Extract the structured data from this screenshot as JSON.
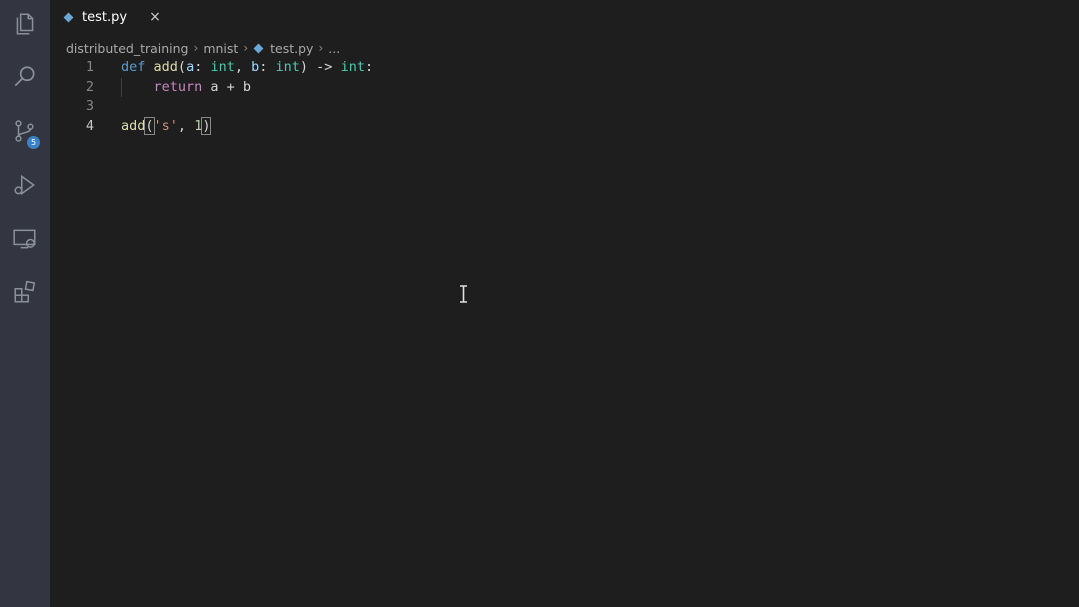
{
  "activity_bar": {
    "icons": [
      "files-icon",
      "search-icon",
      "source-control-icon",
      "run-debug-icon",
      "remote-explorer-icon",
      "extensions-icon"
    ],
    "source_control_badge": "5"
  },
  "tab": {
    "label": "test.py",
    "close_icon": "×"
  },
  "breadcrumb": {
    "items": [
      "distributed_training",
      "mnist",
      "test.py",
      "..."
    ]
  },
  "editor": {
    "lines": [
      {
        "number": "1",
        "tokens": [
          [
            "kw",
            "def"
          ],
          [
            "plain",
            " "
          ],
          [
            "fn",
            "add"
          ],
          [
            "plain",
            "("
          ],
          [
            "param",
            "a"
          ],
          [
            "plain",
            ": "
          ],
          [
            "type",
            "int"
          ],
          [
            "plain",
            ", "
          ],
          [
            "param",
            "b"
          ],
          [
            "plain",
            ": "
          ],
          [
            "type",
            "int"
          ],
          [
            "plain",
            ") -> "
          ],
          [
            "type",
            "int"
          ],
          [
            "plain",
            ":"
          ]
        ]
      },
      {
        "number": "2",
        "tokens": [
          [
            "plain",
            "    "
          ],
          [
            "kw2",
            "return"
          ],
          [
            "plain",
            " a + b"
          ]
        ]
      },
      {
        "number": "3",
        "tokens": []
      },
      {
        "number": "4",
        "tokens": [
          [
            "fn",
            "add"
          ],
          [
            "brk",
            "("
          ],
          [
            "str",
            "'s'"
          ],
          [
            "plain",
            ", "
          ],
          [
            "num",
            "1"
          ],
          [
            "brk",
            ")"
          ]
        ]
      }
    ]
  },
  "colors": {
    "activity_bar": "#333641",
    "editor_bg": "#1e1e1e",
    "badge": "#3b82c4"
  }
}
